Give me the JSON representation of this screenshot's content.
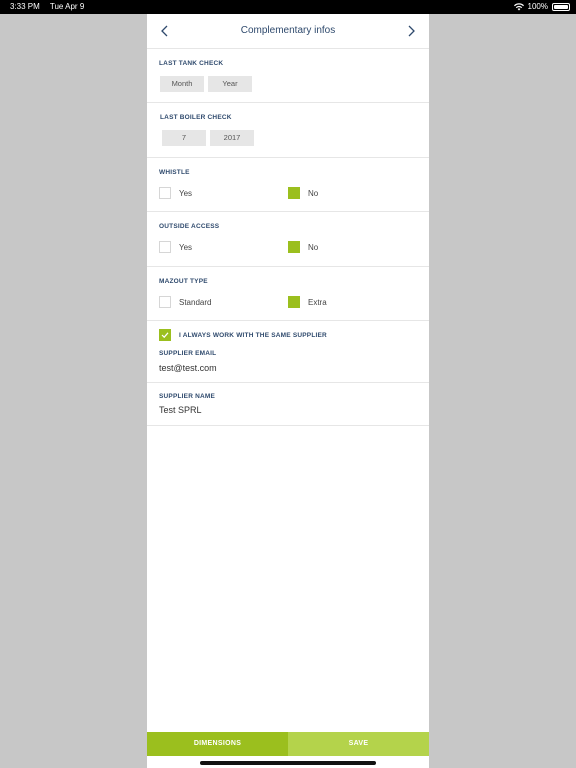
{
  "status_bar": {
    "time": "3:33 PM",
    "date": "Tue Apr 9",
    "battery": "100%"
  },
  "nav": {
    "title": "Complementary infos"
  },
  "last_tank_check": {
    "label": "LAST TANK CHECK",
    "month": "Month",
    "year": "Year"
  },
  "last_boiler_check": {
    "label": "LAST BOILER CHECK",
    "month": "7",
    "year": "2017"
  },
  "whistle": {
    "label": "WHISTLE",
    "yes": "Yes",
    "no": "No",
    "selected": "No"
  },
  "outside_access": {
    "label": "OUTSIDE ACCESS",
    "yes": "Yes",
    "no": "No",
    "selected": "No"
  },
  "mazout_type": {
    "label": "MAZOUT TYPE",
    "standard": "Standard",
    "extra": "Extra",
    "selected": "Extra"
  },
  "supplier": {
    "same_supplier_label": "I ALWAYS WORK WITH THE SAME SUPPLIER",
    "same_supplier_checked": true,
    "email_label": "SUPPLIER EMAIL",
    "email_value": "test@test.com",
    "name_label": "SUPPLIER NAME",
    "name_value": "Test SPRL"
  },
  "bottom": {
    "dimensions": "DIMENSIONS",
    "save": "SAVE"
  },
  "colors": {
    "accent": "#9bbf1e",
    "accent_light": "#b4d34b",
    "title": "#2f4a6d"
  }
}
